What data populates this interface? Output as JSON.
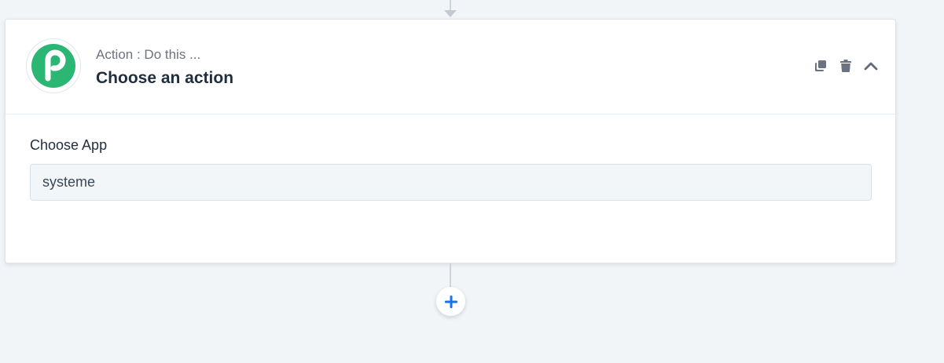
{
  "step": {
    "kind_label": "Action : Do this ...",
    "title": "Choose an action",
    "logo_icon": "pabbly-p-logo",
    "logo_color": "#2bb673"
  },
  "header_actions": [
    {
      "icon": "copy-icon"
    },
    {
      "icon": "trash-icon"
    },
    {
      "icon": "chevron-up-icon"
    }
  ],
  "choose_app": {
    "label": "Choose App",
    "value": "systeme"
  },
  "add_step": {
    "icon": "plus-icon",
    "color": "#1a73e8"
  }
}
